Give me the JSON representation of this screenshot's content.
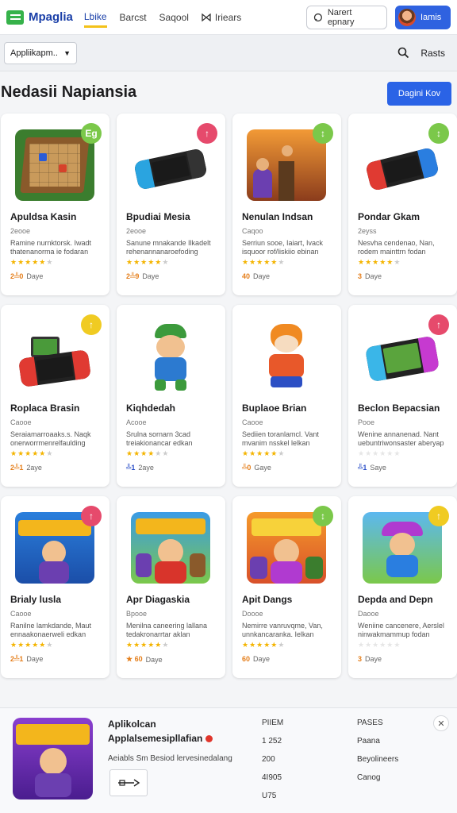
{
  "header": {
    "logo": "Mpaglia",
    "tabs": [
      {
        "label": "Lbike",
        "active": true
      },
      {
        "label": "Barcst"
      },
      {
        "label": "Saqool"
      },
      {
        "label": "Iriears"
      }
    ],
    "search_label": "Narert epnary",
    "profile_label": "Iamis",
    "accent": "#2f62e0"
  },
  "filter": {
    "select_value": "Appliikapm..",
    "right_label": "Rasts"
  },
  "section": {
    "title": "Nedasii Napiansia",
    "button": "Dagini Kov"
  },
  "cards": [
    {
      "title": "Apuldsa Kasin",
      "sub": "2eooe",
      "desc": "Ramine nurnktorsk. Iwadt thatenanorma ie fodaran",
      "foot": "Daye",
      "rating": "2╩0",
      "badge": "Eg",
      "badge_color": "#7bc84a"
    },
    {
      "title": "Bpudiai Mesia",
      "sub": "2eooe",
      "desc": "Sanune mnakande Ilkadelt rehenannanaroefoding",
      "foot": "Daye",
      "rating": "2╩9",
      "badge": "↑",
      "badge_color": "#e64a6c"
    },
    {
      "title": "Nenulan Indsan",
      "sub": "Caqoo",
      "desc": "Serriun sooe, Iaiart, Ivack isquoor rof/liskiio ebinan",
      "foot": "Daye",
      "rating": "40",
      "badge": "↕",
      "badge_color": "#7bc84a"
    },
    {
      "title": "Pondar Gkam",
      "sub": "2eyss",
      "desc": "Nesvha cendenao, Nan, rodem mainttrn fodan",
      "foot": "Daye",
      "rating": "3",
      "badge": "↕",
      "badge_color": "#7bc84a"
    },
    {
      "title": "Roplaca Brasin",
      "sub": "Caooe",
      "desc": "Seraiamarroaaks.s. Naqk onerworrmenrelfaulding",
      "foot": "2aye",
      "rating": "2╩1",
      "badge": "↑",
      "badge_color": "#f0cb22"
    },
    {
      "title": "Kiqhdedah",
      "sub": "Acooe",
      "desc": "Srulna sornarn 3cad treiakionancar edkan",
      "foot": "2aye",
      "rating": "╩1",
      "badge": "",
      "badge_color": ""
    },
    {
      "title": "Buplaoe Brian",
      "sub": "Caooe",
      "desc": "Sediien toranlamcl. Vant mvanim nsskel lelkan",
      "foot": "Gaye",
      "rating": "╩0",
      "badge": "",
      "badge_color": ""
    },
    {
      "title": "Beclon Bepacsian",
      "sub": "Pooe",
      "desc": "Wenine annanenad. Nant uebuntriwonsaster aberyap",
      "foot": "Saye",
      "rating": "╩1",
      "badge": "↑",
      "badge_color": "#e64a6c"
    },
    {
      "title": "Brialy lusla",
      "sub": "Caooe",
      "desc": "Ranilne lamkdande, Maut ennaakonaerweli edkan",
      "foot": "Daye",
      "rating": "2╩1",
      "badge": "↑",
      "badge_color": "#e64a6c"
    },
    {
      "title": "Apr Diagaskia",
      "sub": "Bpooe",
      "desc": "Menilna caneering lallana tedakronarrtar aklan",
      "foot": "Daye",
      "rating": "★ 60",
      "badge": "",
      "badge_color": ""
    },
    {
      "title": "Apit Dangs",
      "sub": "Doooe",
      "desc": "Nemirre vanruvqme, Van, unnkancaranka. Ielkan",
      "foot": "Daye",
      "rating": "60",
      "badge": "↕",
      "badge_color": "#7bc84a"
    },
    {
      "title": "Depda and Depn",
      "sub": "Daooe",
      "desc": "Weniine cancenere, Aerslel ninwakmammup fodan",
      "foot": "Daye",
      "rating": "3",
      "badge": "↑",
      "badge_color": "#f0cb22"
    }
  ],
  "detail": {
    "title": "Aplikolcan",
    "subtitle": "Applalsemesipllafian",
    "line": "Aeiabls Sm Besiod lervesinedalang",
    "key_label": "",
    "col1": [
      "PIIEM",
      "1 252",
      "200",
      "4I905",
      "U75"
    ],
    "col2": [
      "PASES",
      "Paana",
      "Beyolineers",
      "Canog"
    ]
  }
}
